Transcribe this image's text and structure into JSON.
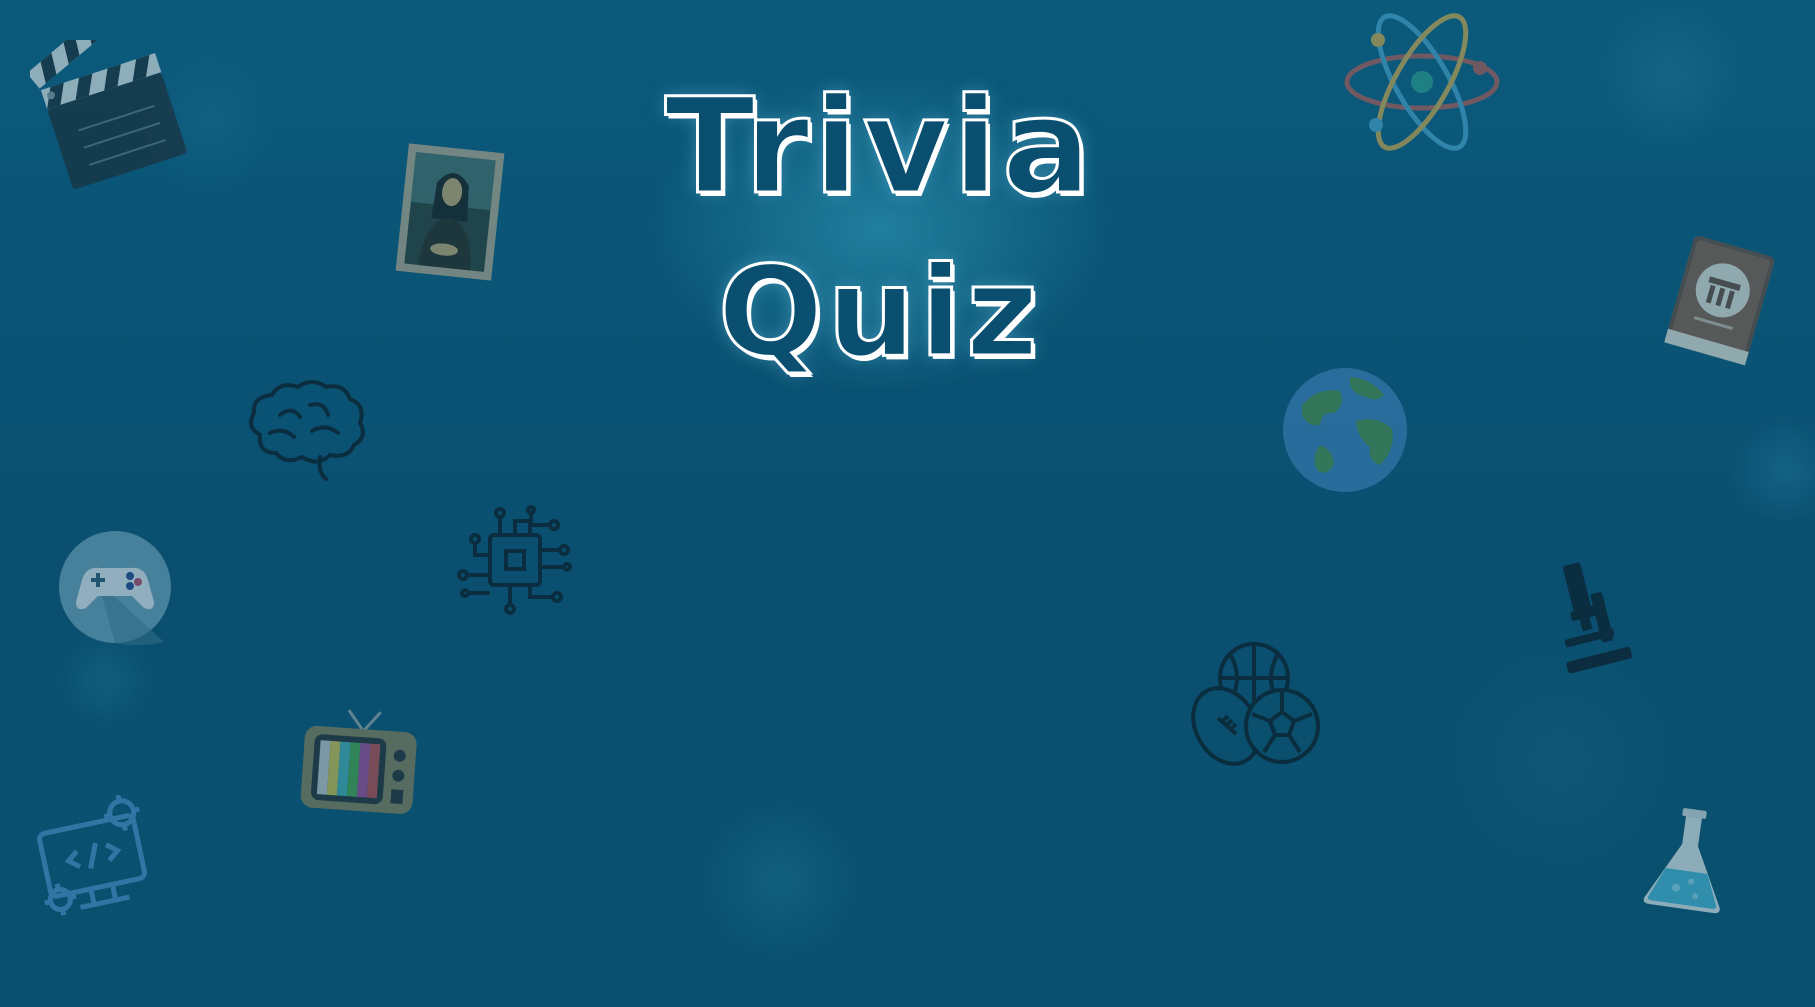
{
  "title": {
    "line1": "Trivia",
    "line2": "Quiz"
  },
  "icons": [
    "clapperboard-icon",
    "mona-lisa-painting-icon",
    "atom-icon",
    "history-book-icon",
    "brain-icon",
    "globe-icon",
    "game-controller-icon",
    "circuit-chip-icon",
    "microscope-icon",
    "television-icon",
    "sports-balls-icon",
    "programming-monitor-icon",
    "chemistry-flask-icon"
  ],
  "colors": {
    "background": "#0a4f70",
    "title": "#ffffff"
  }
}
